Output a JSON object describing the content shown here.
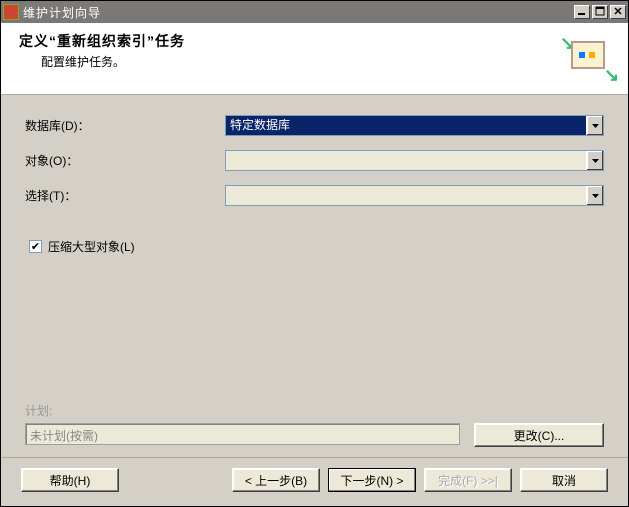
{
  "window": {
    "title": "维护计划向导"
  },
  "header": {
    "title": "定义“重新组织索引”任务",
    "subtitle": "配置维护任务。"
  },
  "form": {
    "database_label": "数据库(D)：",
    "database_value": "特定数据库",
    "object_label": "对象(O)：",
    "object_value": "",
    "select_label": "选择(T)：",
    "select_value": "",
    "checkbox_label": "压缩大型对象(L)"
  },
  "schedule": {
    "label": "计划:",
    "value": "未计划(按需)",
    "change_button": "更改(C)..."
  },
  "footer": {
    "help": "帮助(H)",
    "back": "< 上一步(B)",
    "next": "下一步(N) >",
    "finish": "完成(F) >>|",
    "cancel": "取消"
  }
}
